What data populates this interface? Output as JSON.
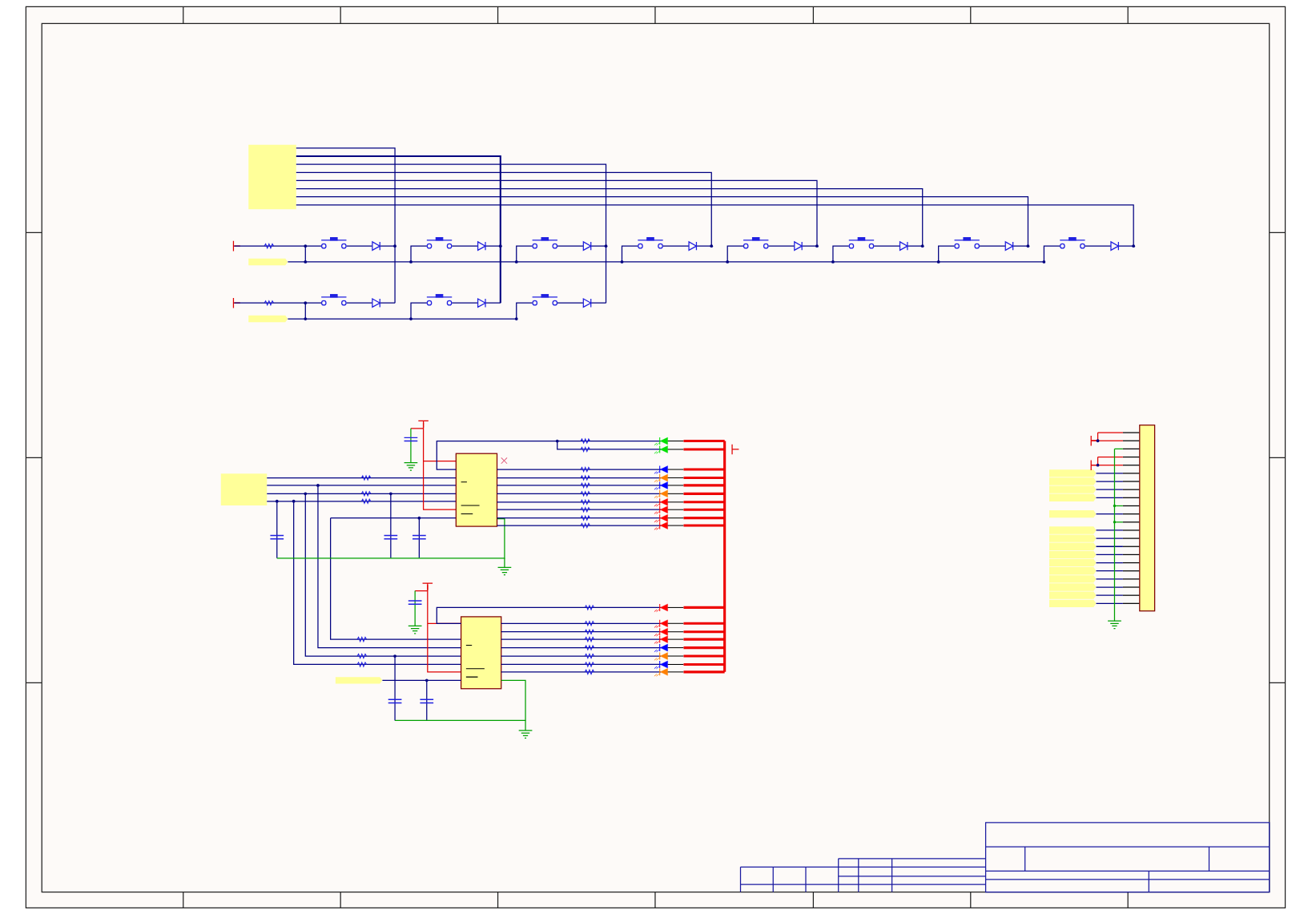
{
  "keypad": {
    "rows": [
      {
        "switches": [
          {
            "kind": "pushbutton"
          },
          {
            "kind": "pushbutton"
          },
          {
            "kind": "pushbutton"
          },
          {
            "kind": "pushbutton"
          },
          {
            "kind": "pushbutton"
          },
          {
            "kind": "pushbutton"
          },
          {
            "kind": "pushbutton"
          },
          {
            "kind": "pushbutton"
          }
        ]
      },
      {
        "switches": [
          {
            "kind": "pushbutton"
          },
          {
            "kind": "pushbutton"
          },
          {
            "kind": "pushbutton"
          }
        ]
      }
    ]
  },
  "drivers": [
    {
      "leds": [
        {
          "color": "#00e000"
        },
        {
          "color": "#00e000"
        },
        {
          "color": "#0000ff"
        },
        {
          "color": "#ff8000"
        },
        {
          "color": "#0000ff"
        },
        {
          "color": "#ff8000"
        },
        {
          "color": "#ff0000"
        },
        {
          "color": "#ff0000"
        },
        {
          "color": "#ff0000"
        },
        {
          "color": "#ff0000"
        }
      ]
    },
    {
      "leds": [
        {
          "color": "#ff0000"
        },
        {
          "color": "#ff0000"
        },
        {
          "color": "#ff0000"
        },
        {
          "color": "#ff0000"
        },
        {
          "color": "#0000ff"
        },
        {
          "color": "#ff8000"
        },
        {
          "color": "#0000ff"
        },
        {
          "color": "#ff8000"
        }
      ]
    }
  ],
  "connector": {
    "pins": [
      {
        "kind": "power"
      },
      {
        "kind": "power"
      },
      {
        "kind": "ground"
      },
      {
        "kind": "power"
      },
      {
        "kind": "power"
      },
      {
        "kind": "signal"
      },
      {
        "kind": "signal"
      },
      {
        "kind": "signal"
      },
      {
        "kind": "signal"
      },
      {
        "kind": "ground"
      },
      {
        "kind": "signal"
      },
      {
        "kind": "ground"
      },
      {
        "kind": "signal"
      },
      {
        "kind": "signal"
      },
      {
        "kind": "signal"
      },
      {
        "kind": "signal"
      },
      {
        "kind": "signal"
      },
      {
        "kind": "signal"
      },
      {
        "kind": "signal"
      },
      {
        "kind": "signal"
      },
      {
        "kind": "signal"
      },
      {
        "kind": "signal"
      }
    ]
  }
}
